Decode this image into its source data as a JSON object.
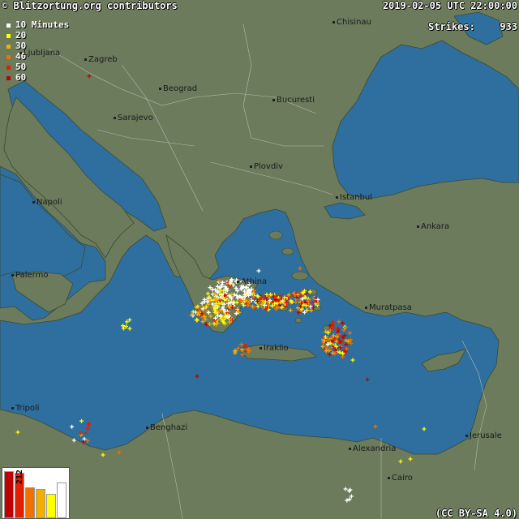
{
  "header": {
    "copyright": "© Blitzortung.org contributors",
    "timestamp": "2019-02-05 UTC 22:00:00",
    "strikes_label": "Strikes:",
    "strikes_count": "933",
    "license": "(CC BY-SA 4.0)"
  },
  "legend": [
    {
      "label": "10 Minutes",
      "color": "#ffffff"
    },
    {
      "label": "20",
      "color": "#ffff00"
    },
    {
      "label": "30",
      "color": "#f0b000"
    },
    {
      "label": "40",
      "color": "#f07000"
    },
    {
      "label": "50",
      "color": "#e02000"
    },
    {
      "label": "60",
      "color": "#c00000"
    }
  ],
  "histogram": {
    "max_label": "212",
    "bars": [
      {
        "value": 212,
        "color": "#c00000"
      },
      {
        "value": 205,
        "color": "#e02000"
      },
      {
        "value": 140,
        "color": "#f07000"
      },
      {
        "value": 130,
        "color": "#f0b000"
      },
      {
        "value": 110,
        "color": "#ffff00"
      },
      {
        "value": 160,
        "color": "#ffffff"
      }
    ]
  },
  "cities": [
    "Chisinau",
    "Ljubljana",
    "Zagreb",
    "Beograd",
    "Bucuresti",
    "Sarajevo",
    "Plovdiv",
    "Istanbul",
    "Napoli",
    "Ankara",
    "Palermo",
    "Athina",
    "Muratpasa",
    "Iraklio",
    "Tripoli",
    "Benghazi",
    "Jerusale",
    "Alexandria",
    "Cairo"
  ],
  "colors": {
    "sea": "#2f6f9f",
    "land": "#6b7b5c"
  }
}
